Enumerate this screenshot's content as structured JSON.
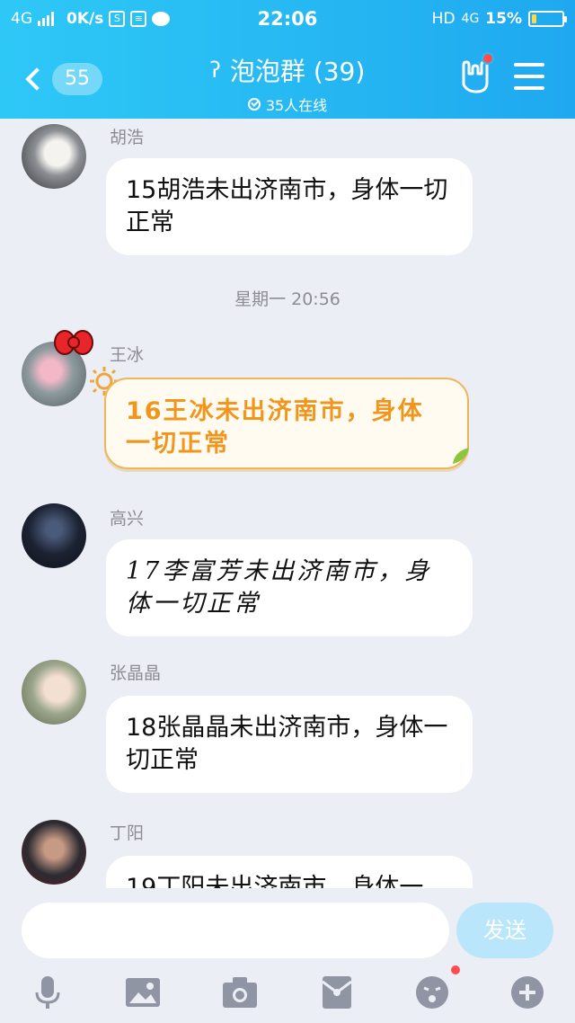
{
  "status_bar": {
    "network_left": "4G",
    "speed": "0K/s",
    "time": "22:06",
    "hd": "HD",
    "network_right": "4G",
    "battery": "15%",
    "battery_level": 0.15,
    "icons": [
      "signal-icon",
      "sim-icon",
      "app-icon",
      "message-icon",
      "battery-icon"
    ]
  },
  "header": {
    "back_badge": "55",
    "title": "泡泡群 (39)",
    "subtitle": "35人在线",
    "colors": {
      "bar_start": "#2ec8f6",
      "bar_end": "#1fa8f0"
    }
  },
  "messages": [
    {
      "name": "胡浩",
      "text": "15胡浩未出济南市，身体一切正常",
      "style": "normal"
    },
    {
      "timestamp": "星期一 20:56"
    },
    {
      "name": "王冰",
      "text": "16王冰未出济南市，身体一切正常",
      "style": "special"
    },
    {
      "name": "高兴",
      "text": "17李富芳未出济南市，身体一切正常",
      "style": "script"
    },
    {
      "name": "张晶晶",
      "text": "18张晶晶未出济南市，身体一切正常",
      "style": "normal"
    },
    {
      "name": "丁阳",
      "text": "19丁阳未出济南市，身体一",
      "style": "normal"
    }
  ],
  "input": {
    "placeholder": "",
    "send_label": "发送"
  },
  "toolbar": [
    "microphone-icon",
    "image-icon",
    "camera-icon",
    "red-packet-icon",
    "emoji-icon",
    "plus-icon"
  ]
}
